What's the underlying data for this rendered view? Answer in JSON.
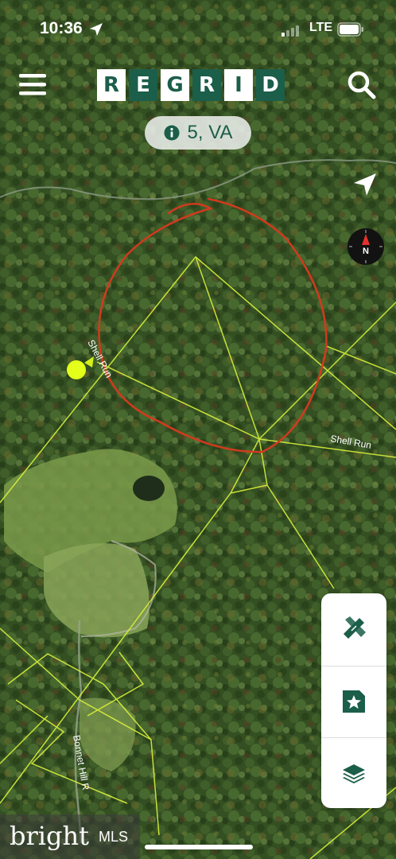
{
  "status_bar": {
    "time": "10:36",
    "network": "LTE"
  },
  "header": {
    "logo_letters": [
      "R",
      "E",
      "G",
      "R",
      "I",
      "D"
    ],
    "location_pill": "5, VA"
  },
  "map": {
    "road_labels": {
      "shell_run_1": "Shell Run",
      "shell_run_2": "Shell Run",
      "bonnet_hill": "Bonnet Hill R"
    },
    "parcel_line_color": "#d8f03a",
    "annotation_color": "#d23a1e",
    "marker_color": "#e4ff1a"
  },
  "compass": {
    "label": "N"
  },
  "tools": [
    "pencil-ruler-icon",
    "saved-star-icon",
    "layers-icon"
  ],
  "watermark": {
    "brand": "bright",
    "suffix": "MLS"
  }
}
